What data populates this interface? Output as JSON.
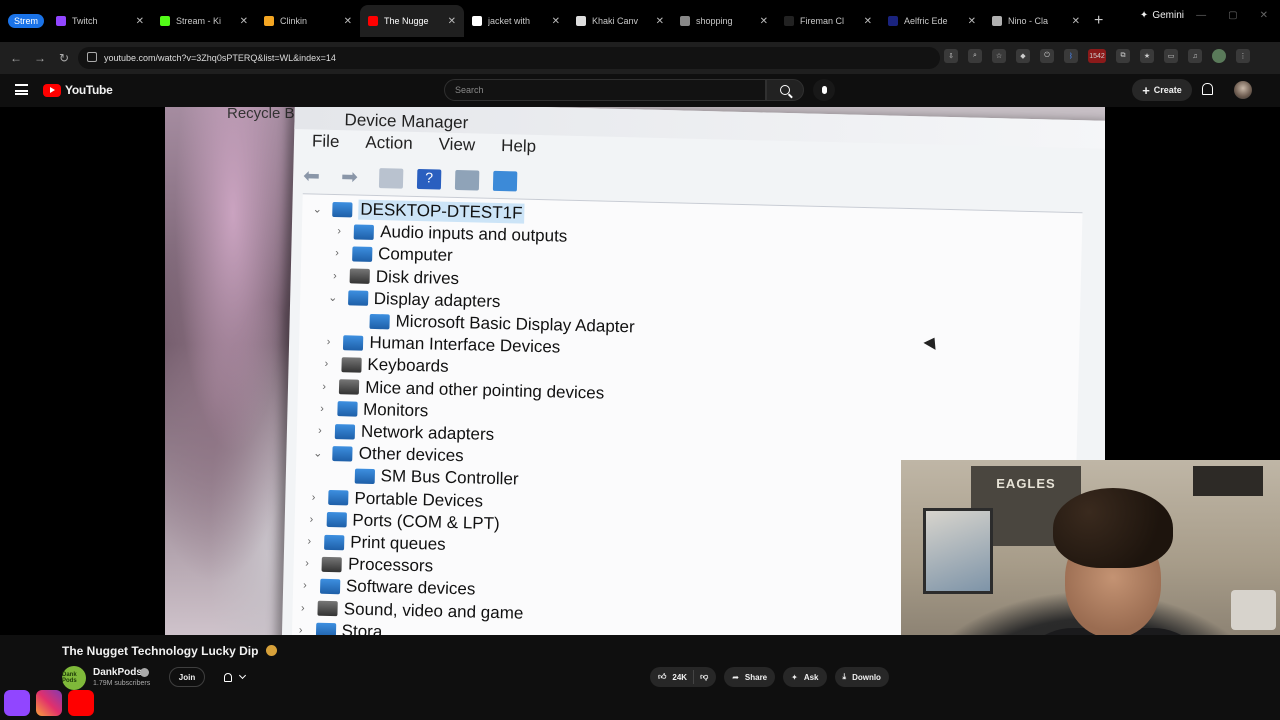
{
  "browser": {
    "tab_group_label": "Strem",
    "tabs": [
      {
        "title": "Twitch",
        "color": "#9146ff",
        "active": false
      },
      {
        "title": "Stream - Ki",
        "color": "#53fc18",
        "active": false
      },
      {
        "title": "Clinkin",
        "color": "#f4a623",
        "active": false
      },
      {
        "title": "The Nugge",
        "color": "#ff0000",
        "active": true
      },
      {
        "title": "jacket with",
        "color": "#ffffff",
        "active": false
      },
      {
        "title": "Khaki Canv",
        "color": "#dddddd",
        "active": false
      },
      {
        "title": "shopping",
        "color": "#888888",
        "active": false
      },
      {
        "title": "Fireman Cl",
        "color": "#222222",
        "active": false
      },
      {
        "title": "Aelfric Ede",
        "color": "#1a237e",
        "active": false
      },
      {
        "title": "Nino - Cla",
        "color": "#b0b0b0",
        "active": false
      }
    ],
    "gemini_label": "Gemini",
    "url": "youtube.com/watch?v=3Zhq0sPTERQ&list=WL&index=14",
    "extension_badge": "1542"
  },
  "youtube": {
    "logo_text": "YouTube",
    "search_placeholder": "Search",
    "create_label": "Create",
    "video": {
      "title": "The Nugget Technology Lucky Dip",
      "channel": "DankPods",
      "channel_avatar_text": "Dank Pods",
      "subscribers": "1.79M subscribers",
      "join_label": "Join",
      "likes": "24K",
      "share_label": "Share",
      "ask_label": "Ask",
      "download_label": "Downlo"
    }
  },
  "video_content": {
    "desktop_label": "Recycle Bin",
    "window_title": "Device Manager",
    "menu": [
      "File",
      "Action",
      "View",
      "Help"
    ],
    "tree": [
      {
        "label": "DESKTOP-DTEST1F",
        "level": 0,
        "expanded": true,
        "root": true
      },
      {
        "label": "Audio inputs and outputs",
        "level": 1,
        "expanded": false
      },
      {
        "label": "Computer",
        "level": 1,
        "expanded": false
      },
      {
        "label": "Disk drives",
        "level": 1,
        "expanded": false
      },
      {
        "label": "Display adapters",
        "level": 1,
        "expanded": true
      },
      {
        "label": "Microsoft Basic Display Adapter",
        "level": 2,
        "expanded": null
      },
      {
        "label": "Human Interface Devices",
        "level": 1,
        "expanded": false
      },
      {
        "label": "Keyboards",
        "level": 1,
        "expanded": false
      },
      {
        "label": "Mice and other pointing devices",
        "level": 1,
        "expanded": false
      },
      {
        "label": "Monitors",
        "level": 1,
        "expanded": false
      },
      {
        "label": "Network adapters",
        "level": 1,
        "expanded": false
      },
      {
        "label": "Other devices",
        "level": 1,
        "expanded": true
      },
      {
        "label": "SM Bus Controller",
        "level": 2,
        "expanded": null
      },
      {
        "label": "Portable Devices",
        "level": 1,
        "expanded": false
      },
      {
        "label": "Ports (COM & LPT)",
        "level": 1,
        "expanded": false
      },
      {
        "label": "Print queues",
        "level": 1,
        "expanded": false
      },
      {
        "label": "Processors",
        "level": 1,
        "expanded": false
      },
      {
        "label": "Software devices",
        "level": 1,
        "expanded": false
      },
      {
        "label": "Sound, video and game",
        "level": 1,
        "expanded": false
      },
      {
        "label": "Stora",
        "level": 1,
        "expanded": false
      }
    ],
    "webcam_poster": "EAGLES"
  },
  "colors": {
    "yt_red": "#ff0000",
    "accent_blue": "#1a73e8",
    "bg": "#0f0f0f"
  }
}
